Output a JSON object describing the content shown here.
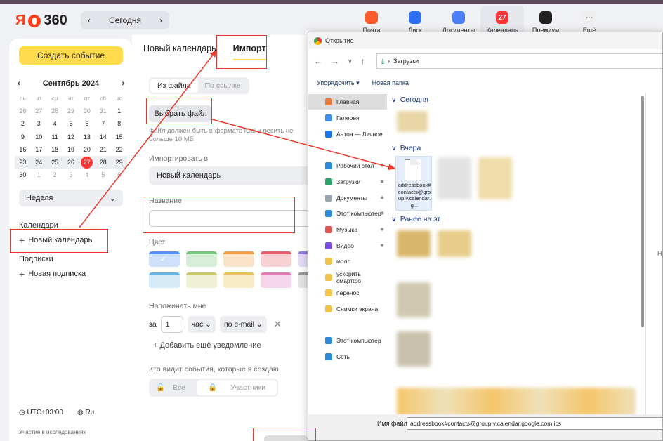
{
  "header": {
    "logo_ya": "Я",
    "logo_num": "360",
    "date_label": "Сегодня",
    "apps": [
      {
        "label": "Почта",
        "color": "#fc5a2b",
        "glyph": ""
      },
      {
        "label": "Диск",
        "color": "#2d6ff0",
        "glyph": ""
      },
      {
        "label": "Документы",
        "color": "#4b7df7",
        "glyph": ""
      },
      {
        "label": "Календарь",
        "color": "#f33",
        "glyph": "27"
      },
      {
        "label": "Премиум",
        "color": "#222",
        "glyph": ""
      },
      {
        "label": "Ещё",
        "color": "#eee",
        "glyph": "⋯"
      }
    ]
  },
  "sidebar": {
    "create_label": "Создать событие",
    "month_label": "Сентябрь 2024",
    "weekdays": [
      "пн",
      "вт",
      "ср",
      "чт",
      "пт",
      "сб",
      "вс"
    ],
    "days": [
      "26",
      "27",
      "28",
      "29",
      "30",
      "31",
      "1",
      "2",
      "3",
      "4",
      "5",
      "6",
      "7",
      "8",
      "9",
      "10",
      "11",
      "12",
      "13",
      "14",
      "15",
      "16",
      "17",
      "18",
      "19",
      "20",
      "21",
      "22",
      "23",
      "24",
      "25",
      "26",
      "27",
      "28",
      "29",
      "30",
      "1",
      "2",
      "3",
      "4",
      "5",
      "6"
    ],
    "view_label": "Неделя",
    "calendars_title": "Календари",
    "new_calendar_label": "Новый календарь",
    "subscriptions_title": "Подписки",
    "new_subscription_label": "Новая подписка",
    "timezone": "UTC+03:00",
    "language": "Ru",
    "research_note": "Участие в исследованиях"
  },
  "main": {
    "tab_new": "Новый календарь",
    "tab_import": "Импорт",
    "seg_file": "Из файла",
    "seg_link": "По ссылке",
    "pick_file_label": "Выбрать файл",
    "hint": "Файл должен быть в формате iCal и весить не больше 10 МБ",
    "import_into_label": "Импортировать в",
    "import_into_value": "Новый календарь",
    "name_label": "Название",
    "color_label": "Цвет",
    "remind_label": "Напоминать мне",
    "remind_prefix": "за",
    "remind_num": "1",
    "remind_unit": "час",
    "remind_method": "по e-mail",
    "add_reminder_label": "Добавить ещё уведомление",
    "visibility_label": "Кто видит события, которые я создаю",
    "vis_all": "Все",
    "vis_members": "Участники",
    "colors": [
      {
        "top": "#5a8ef0",
        "fill": "#cfe0fb"
      },
      {
        "top": "#7cc47f",
        "fill": "#d7eed8"
      },
      {
        "top": "#f0a050",
        "fill": "#fbe3c9"
      },
      {
        "top": "#e0606c",
        "fill": "#f6d2d5"
      },
      {
        "top": "#9a7be0",
        "fill": "#e5dcf7"
      },
      {
        "top": "#66b5e0",
        "fill": "#d4ebf7"
      },
      {
        "top": "#c9c96a",
        "fill": "#eff0d4"
      },
      {
        "top": "#e6c25c",
        "fill": "#f8ebc8"
      },
      {
        "top": "#e07bb5",
        "fill": "#f6d6ea"
      },
      {
        "top": "#999999",
        "fill": "#e4e4e4"
      }
    ]
  },
  "dialog": {
    "title": "Открытие",
    "path_folder": "Загрузки",
    "organize_label": "Упорядочить",
    "new_folder_label": "Новая папка",
    "nav_items": [
      {
        "label": "Главная",
        "color": "#e87a3a",
        "pinned": false
      },
      {
        "label": "Галерея",
        "color": "#3a8ee8",
        "pinned": false
      },
      {
        "label": "Антон — Личное",
        "color": "#1a73e8",
        "pinned": false
      },
      {
        "label": "Рабочий стол",
        "color": "#2d8ad8",
        "pinned": true
      },
      {
        "label": "Загрузки",
        "color": "#2aa36b",
        "pinned": true
      },
      {
        "label": "Документы",
        "color": "#9aa3b0",
        "pinned": true
      },
      {
        "label": "Этот компьютер",
        "color": "#2d8ad8",
        "pinned": true
      },
      {
        "label": "Музыка",
        "color": "#e05454",
        "pinned": true
      },
      {
        "label": "Видео",
        "color": "#7b4ce0",
        "pinned": true
      },
      {
        "label": "молл",
        "color": "#f2c24a",
        "pinned": false
      },
      {
        "label": "ускорить смартфо",
        "color": "#f2c24a",
        "pinned": false
      },
      {
        "label": "перенос",
        "color": "#f2c24a",
        "pinned": false
      },
      {
        "label": "Снимки экрана",
        "color": "#f2c24a",
        "pinned": false
      },
      {
        "label": "Этот компьютер",
        "color": "#2d8ad8",
        "pinned": false
      },
      {
        "label": "Сеть",
        "color": "#2d8ad8",
        "pinned": false
      }
    ],
    "group_today": "Сегодня",
    "group_yesterday": "Вчера",
    "group_earlier": "Ранее на эт",
    "selected_file": "addressbook#contacts@group.v.calendar.g...",
    "filename_label": "Имя файла:",
    "filename_value": "addressbook#contacts@group.v.calendar.google.com.ics",
    "preview_letter": "Н"
  }
}
